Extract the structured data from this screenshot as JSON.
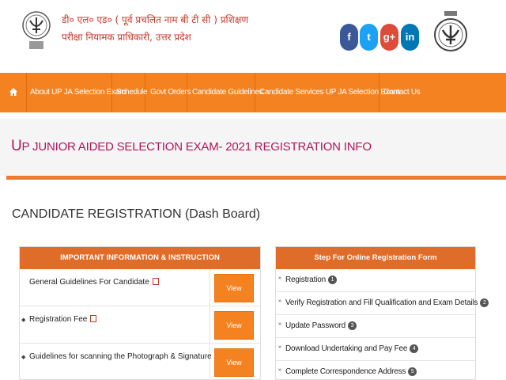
{
  "header": {
    "org_line1": "डी० एल० एड० ( पूर्व प्रचलित नाम बी टी सी ) प्रशिक्षण",
    "org_line2": "परीक्षा नियामक प्राधिकारी, उत्तर प्रदेश",
    "social": [
      {
        "name": "facebook",
        "glyph": "f",
        "color": "#3b5998"
      },
      {
        "name": "twitter",
        "glyph": "t",
        "color": "#1da1f2"
      },
      {
        "name": "google-plus",
        "glyph": "g+",
        "color": "#dd4b39"
      },
      {
        "name": "linkedin",
        "glyph": "in",
        "color": "#0077b5"
      }
    ]
  },
  "nav": {
    "home_icon": "home-icon",
    "items": [
      "About UP JA Selection Exam",
      "Schedule",
      "Govt Orders",
      "Candidate Guidelines",
      "Candidate Services UP JA Selection Exam",
      "Contact Us"
    ]
  },
  "page": {
    "title_first": "U",
    "title_rest": "P JUNIOR AIDED SELECTION EXAM- 2021 REGISTRATION INFO",
    "section_title": "CANDIDATE REGISTRATION (Dash Board)"
  },
  "info_panel": {
    "heading": "IMPORTANT INFORMATION & INSTRUCTION",
    "rows": [
      {
        "label": "General Guidelines For Candidate",
        "button": "View"
      },
      {
        "label": "Registration Fee",
        "button": "View"
      },
      {
        "label": "Guidelines for scanning the Photograph & Signature",
        "button": "View"
      }
    ]
  },
  "steps_panel": {
    "heading": "Step For Online Registration Form",
    "steps": [
      {
        "label": "Registration",
        "num": "1"
      },
      {
        "label": "Verify Registration and Fill Qualification and Exam Details",
        "num": "2"
      },
      {
        "label": "Update Password",
        "num": "3"
      },
      {
        "label": "Download Undertaking and Pay Fee",
        "num": "4"
      },
      {
        "label": "Complete Correspondence Address",
        "num": "5"
      }
    ]
  },
  "colors": {
    "accent_orange": "#f58220",
    "panel_header": "#e06c2a",
    "title_magenta": "#b0165a"
  }
}
